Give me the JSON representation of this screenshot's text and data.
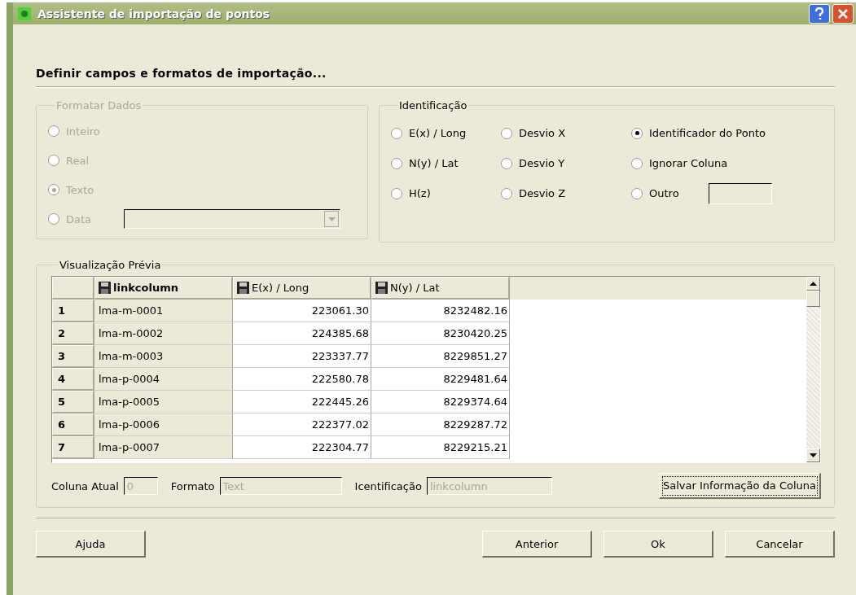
{
  "window": {
    "title": "Assistente de importação de pontos"
  },
  "heading": "Definir campos e formatos de importação...",
  "format_group": {
    "title": "Formatar Dados",
    "disabled": true,
    "options": [
      {
        "label": "Inteiro",
        "selected": false,
        "kind": "radio"
      },
      {
        "label": "Real",
        "selected": false,
        "kind": "radio"
      },
      {
        "label": "Texto",
        "selected": true,
        "kind": "radio"
      },
      {
        "label": "Data",
        "selected": false,
        "kind": "dropdown"
      }
    ]
  },
  "identification_group": {
    "title": "Identificação",
    "options": [
      {
        "label": "E(x) / Long",
        "selected": false,
        "kind": "radio"
      },
      {
        "label": "Desvio X",
        "selected": false,
        "kind": "radio"
      },
      {
        "label": "Identificador do Ponto",
        "selected": true,
        "kind": "radio"
      },
      {
        "label": "N(y) / Lat",
        "selected": false,
        "kind": "radio"
      },
      {
        "label": "Desvio Y",
        "selected": false,
        "kind": "radio"
      },
      {
        "label": "Ignorar Coluna",
        "selected": false,
        "kind": "radio"
      },
      {
        "label": "H(z)",
        "selected": false,
        "kind": "radio"
      },
      {
        "label": "Desvio Z",
        "selected": false,
        "kind": "radio"
      },
      {
        "label": "Outro",
        "selected": false,
        "kind": "field"
      }
    ]
  },
  "preview": {
    "title": "Visualização Prévia",
    "columns": [
      {
        "label": "linkcolumn",
        "selected": true
      },
      {
        "label": "E(x) / Long",
        "selected": false
      },
      {
        "label": "N(y) / Lat",
        "selected": false
      }
    ],
    "rows": [
      {
        "number": "1",
        "cells": [
          "lma-m-0001",
          "223061.30",
          "8232482.16"
        ]
      },
      {
        "number": "2",
        "cells": [
          "lma-m-0002",
          "224385.68",
          "8230420.25"
        ]
      },
      {
        "number": "3",
        "cells": [
          "lma-m-0003",
          "223337.77",
          "8229851.27"
        ]
      },
      {
        "number": "4",
        "cells": [
          "lma-p-0004",
          "222580.78",
          "8229481.64"
        ]
      },
      {
        "number": "5",
        "cells": [
          "lma-p-0005",
          "222445.26",
          "8229374.64"
        ]
      },
      {
        "number": "6",
        "cells": [
          "lma-p-0006",
          "222377.02",
          "8229287.72"
        ]
      },
      {
        "number": "7",
        "cells": [
          "lma-p-0007",
          "222304.77",
          "8229215.21"
        ]
      }
    ],
    "fields": [
      {
        "label": "Coluna Atual",
        "value": "0"
      },
      {
        "label": "Formato",
        "value": "Text"
      },
      {
        "label": "Icentificação",
        "value": "linkcolumn"
      }
    ],
    "save_button": "Salvar Informação da Coluna"
  },
  "help_button": "Ajuda",
  "buttons": [
    "Anterior",
    "Ok",
    "Cancelar"
  ]
}
